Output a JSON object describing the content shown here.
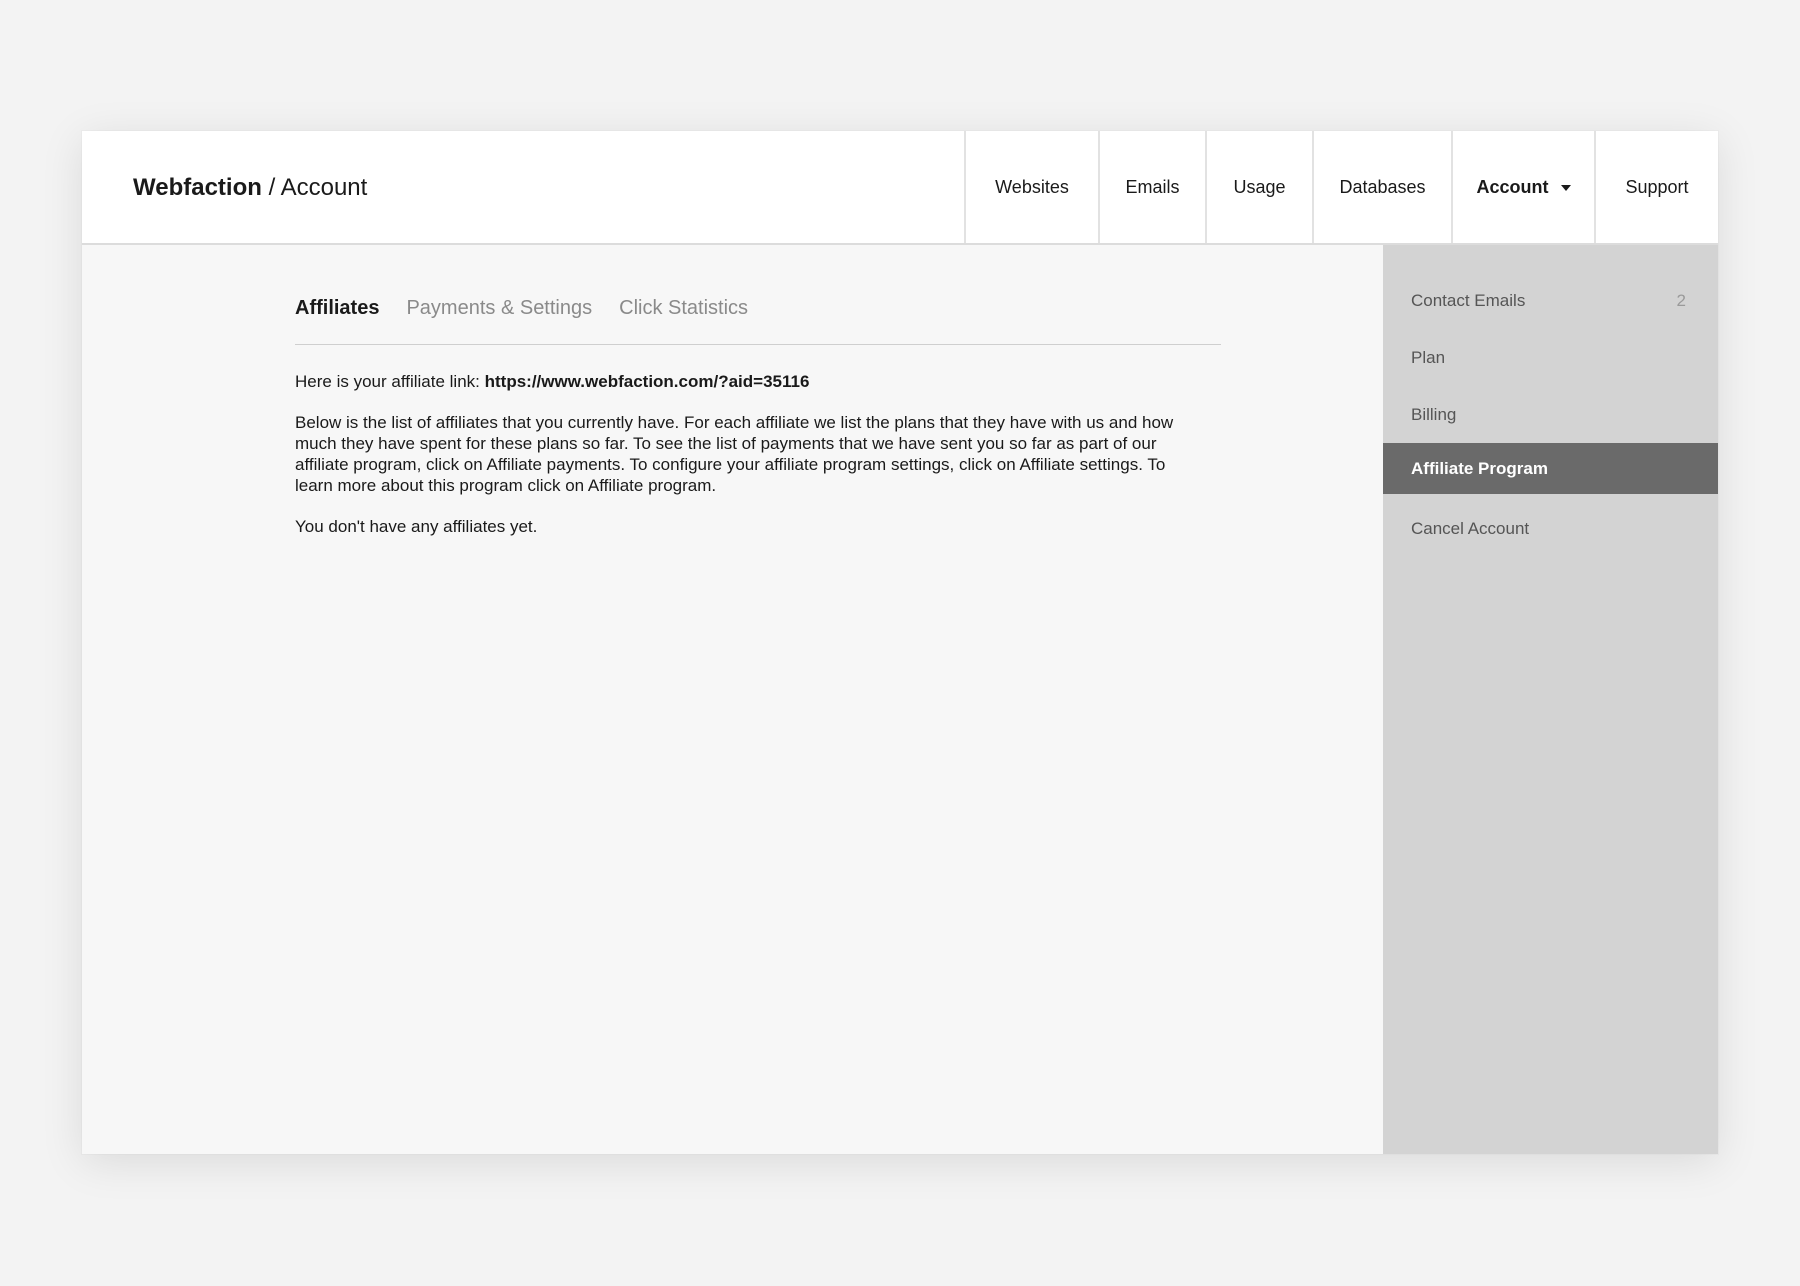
{
  "header": {
    "brand_name": "Webfaction",
    "separator": " / ",
    "section": "Account"
  },
  "nav": {
    "items": [
      {
        "label": "Websites"
      },
      {
        "label": "Emails"
      },
      {
        "label": "Usage"
      },
      {
        "label": "Databases"
      },
      {
        "label": "Account",
        "active": true,
        "icon": "caret-down-icon"
      },
      {
        "label": "Support"
      }
    ]
  },
  "tabs": [
    {
      "label": "Affiliates",
      "active": true
    },
    {
      "label": "Payments & Settings"
    },
    {
      "label": "Click Statistics"
    }
  ],
  "content": {
    "link_prefix": "Here is your affiliate link: ",
    "link_url": "https://www.webfaction.com/?aid=35116",
    "description": "Below is the list of affiliates that you currently have. For each affiliate we list the plans that they have with us and how much they have spent for these plans so far. To see the list of payments that we have sent you so far as part of our affiliate program, click on Affiliate payments. To configure your affiliate program settings, click on Affiliate settings. To learn more about this program click on Affiliate program.",
    "empty_message": "You don't have any affiliates yet."
  },
  "sidebar": {
    "items": [
      {
        "label": "Contact Emails",
        "count": "2"
      },
      {
        "label": "Plan"
      },
      {
        "label": "Billing"
      },
      {
        "label": "Affiliate Program",
        "active": true
      },
      {
        "label": "Cancel Account"
      }
    ]
  },
  "colors": {
    "page_background": "#f3f3f3",
    "topbar_background": "#ffffff",
    "main_background": "#f7f7f7",
    "sidebar_background": "#d3d3d3",
    "sidebar_active_background": "#6a6a6a",
    "inactive_tab_text": "#8a8a8a"
  }
}
